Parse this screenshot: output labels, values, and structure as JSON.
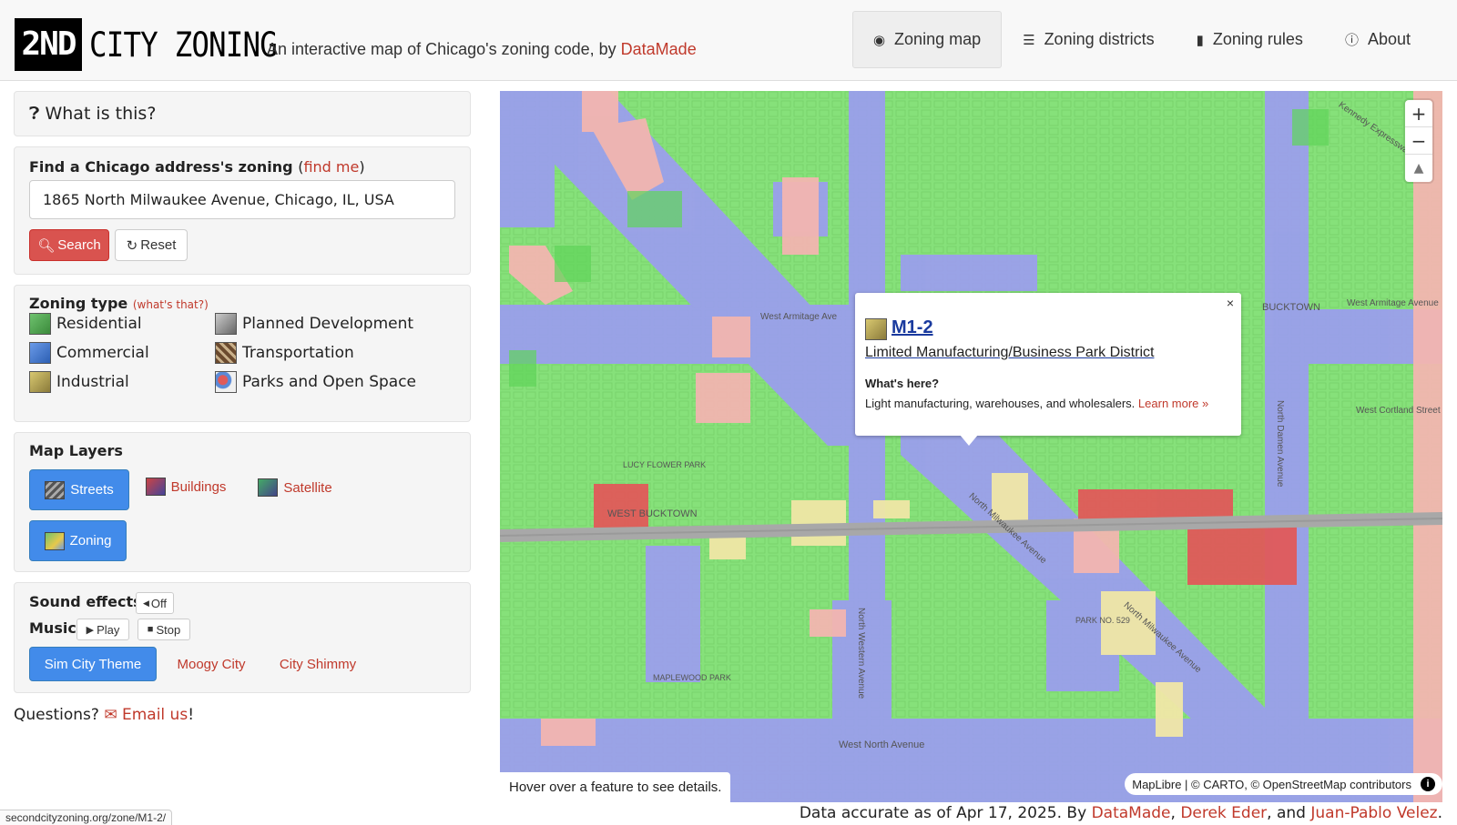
{
  "header": {
    "logo_box": "2ND",
    "logo_text": "CITY ZONING",
    "tagline_prefix": "An interactive map of Chicago's zoning code, by ",
    "tagline_link": "DataMade",
    "nav": [
      {
        "icon": "map-marker-icon",
        "label": "Zoning map"
      },
      {
        "icon": "list-icon",
        "label": "Zoning districts"
      },
      {
        "icon": "book-icon",
        "label": "Zoning rules"
      },
      {
        "icon": "info-icon",
        "label": "About"
      }
    ]
  },
  "what": {
    "label": "What is this?"
  },
  "find": {
    "title": "Find a Chicago address's zoning",
    "find_me": "find me",
    "address_value": "1865 North Milwaukee Avenue, Chicago, IL, USA",
    "search_label": "Search",
    "reset_label": "Reset"
  },
  "zoning_type": {
    "title": "Zoning type",
    "whats_that": "(what's that?)",
    "items": [
      {
        "label": "Residential",
        "color": "#3b8a3b"
      },
      {
        "label": "Commercial",
        "color": "#2c5fb3"
      },
      {
        "label": "Industrial",
        "color": "#8a7a3a"
      },
      {
        "label": "Planned Development",
        "color": "#888888"
      },
      {
        "label": "Transportation",
        "color": "#6b4a2e"
      },
      {
        "label": "Parks and Open Space",
        "color": "#c04040"
      }
    ]
  },
  "layers": {
    "title": "Map Layers",
    "items": [
      {
        "label": "Streets",
        "active": true
      },
      {
        "label": "Buildings",
        "active": false
      },
      {
        "label": "Satellite",
        "active": false
      },
      {
        "label": "Zoning",
        "active": true
      }
    ]
  },
  "sound": {
    "effects_label": "Sound effects",
    "effects_toggle": "Off",
    "music_label": "Music",
    "play_label": "Play",
    "stop_label": "Stop",
    "tracks": [
      "Sim City Theme",
      "Moogy City",
      "City Shimmy"
    ]
  },
  "questions": {
    "prefix": "Questions?",
    "link": "Email us",
    "suffix": "!"
  },
  "map": {
    "popup": {
      "zone": "M1-2",
      "description": "Limited Manufacturing/Business Park District",
      "whats_here": "What's here?",
      "details": "Light manufacturing, warehouses, and wholesalers.",
      "learn_more": "Learn more »",
      "close": "×"
    },
    "hover_hint": "Hover over a feature to see details.",
    "attribution": "MapLibre | © CARTO, © OpenStreetMap contributors",
    "labels": [
      "West Armitage Ave",
      "BUCKTOWN",
      "West Armitage Avenue",
      "West Cortland Street",
      "LUCY FLOWER PARK",
      "WEST BUCKTOWN",
      "North Milwaukee Avenue",
      "North Damen Avenue",
      "North Western Avenue",
      "PARK NO. 529",
      "MAPLEWOOD PARK",
      "West North Avenue",
      "North Milwaukee Avenue",
      "Kennedy Expressway"
    ],
    "colors": {
      "residential": "#86e17a",
      "commercial": "#9c9cf2",
      "industrial": "#f0e7a6",
      "planned": "#f2b5b0",
      "parks": "#e05a5a"
    }
  },
  "status_url": "secondcityzoning.org/zone/M1-2/",
  "footer": {
    "prefix": "Data accurate as of Apr 17, 2025. By ",
    "author1": "DataMade",
    "sep1": ", ",
    "author2": "Derek Eder",
    "sep2": ", and ",
    "author3": "Juan-Pablo Velez",
    "suffix": "."
  }
}
